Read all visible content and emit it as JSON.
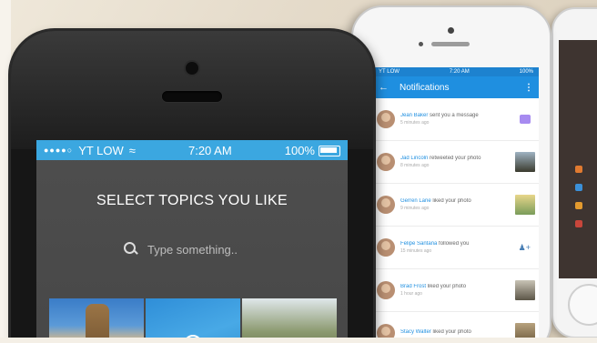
{
  "front_phone": {
    "status": {
      "carrier": "YT LOW",
      "time": "7:20 AM",
      "battery": "100%"
    },
    "headline": "SELECT TOPICS YOU LIKE",
    "search": {
      "placeholder": "Type something..",
      "icon": "search-icon"
    },
    "tiles": [
      {
        "name": "topic-tile-architecture",
        "selected": false
      },
      {
        "name": "topic-tile-selected",
        "selected": true
      },
      {
        "name": "topic-tile-outdoors",
        "selected": false
      }
    ],
    "accent": "#3ba7e0"
  },
  "middle_phone": {
    "status": {
      "carrier": "YT LOW",
      "time": "7:20 AM",
      "battery": "100%"
    },
    "title": "Notifications",
    "accent": "#1f8fe0",
    "items": [
      {
        "who": "Jean Baker",
        "text": "sent you a message",
        "time": "5 minutes ago",
        "trailing": "chat-icon"
      },
      {
        "who": "Jad Lincoln",
        "text": "retweeted your photo",
        "time": "8 minutes ago",
        "trailing": "photo-thumb"
      },
      {
        "who": "Gerren Lane",
        "text": "liked your photo",
        "time": "9 minutes ago",
        "trailing": "photo-thumb"
      },
      {
        "who": "Felipe Santana",
        "text": "followed you",
        "time": "15 minutes ago",
        "trailing": "add-user-icon"
      },
      {
        "who": "Brad Frost",
        "text": "liked your photo",
        "time": "1 hour ago",
        "trailing": "photo-thumb"
      },
      {
        "who": "Stacy Walter",
        "text": "liked your photo",
        "time": "",
        "trailing": "photo-thumb"
      }
    ]
  }
}
